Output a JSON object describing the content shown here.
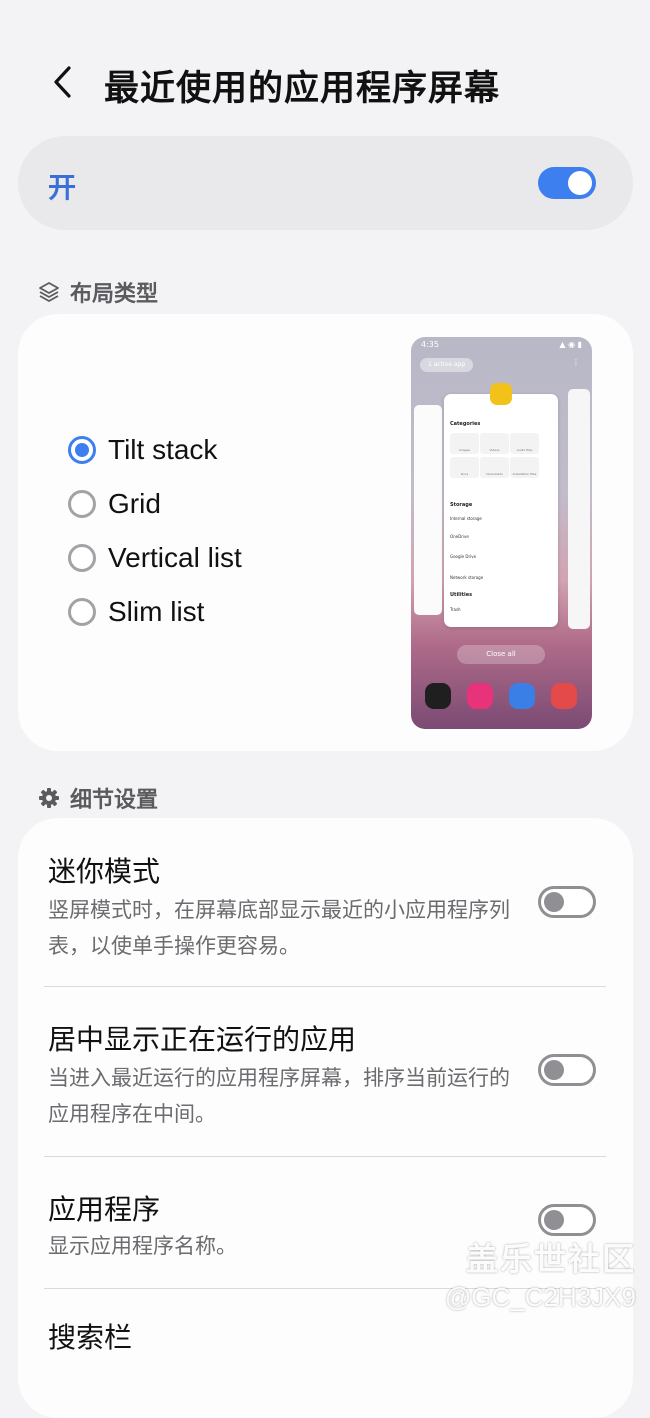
{
  "header": {
    "title": "最近使用的应用程序屏幕",
    "back_icon": "chevron-left-icon"
  },
  "master_toggle": {
    "label": "开",
    "state": true
  },
  "layout_section": {
    "label": "布局类型",
    "icon": "layers-icon"
  },
  "layout_options": [
    {
      "label": "Tilt stack",
      "selected": true
    },
    {
      "label": "Grid",
      "selected": false
    },
    {
      "label": "Vertical list",
      "selected": false
    },
    {
      "label": "Slim list",
      "selected": false
    }
  ],
  "preview": {
    "time": "4:35",
    "active_apps": "1 active app",
    "categories_title": "Categories",
    "categories": [
      "Images",
      "Videos",
      "Audio files",
      "Docs",
      "Downloads",
      "Installation files"
    ],
    "storage_title": "Storage",
    "storage_items": [
      "Internal storage",
      "OneDrive",
      "Google Drive",
      "Network storage"
    ],
    "utilities_title": "Utilities",
    "utility_items": [
      "Trash"
    ],
    "close_all": "Close all"
  },
  "details_section": {
    "label": "细节设置",
    "icon": "gear-icon"
  },
  "details": [
    {
      "title": "迷你模式",
      "description": "竖屏模式时，在屏幕底部显示最近的小应用程序列表，以使单手操作更容易。",
      "state": false
    },
    {
      "title": "居中显示正在运行的应用",
      "description": "当进入最近运行的应用程序屏幕，排序当前运行的应用程序在中间。",
      "state": false
    },
    {
      "title": "应用程序",
      "description": "显示应用程序名称。",
      "state": false
    },
    {
      "title": "搜索栏"
    }
  ],
  "watermark": {
    "text": "盖乐世社区",
    "user": "@GC_C2H3JX9"
  },
  "colors": {
    "accent": "#3e7ff0",
    "background": "#f3f3f5",
    "card": "#fdfdfd"
  }
}
